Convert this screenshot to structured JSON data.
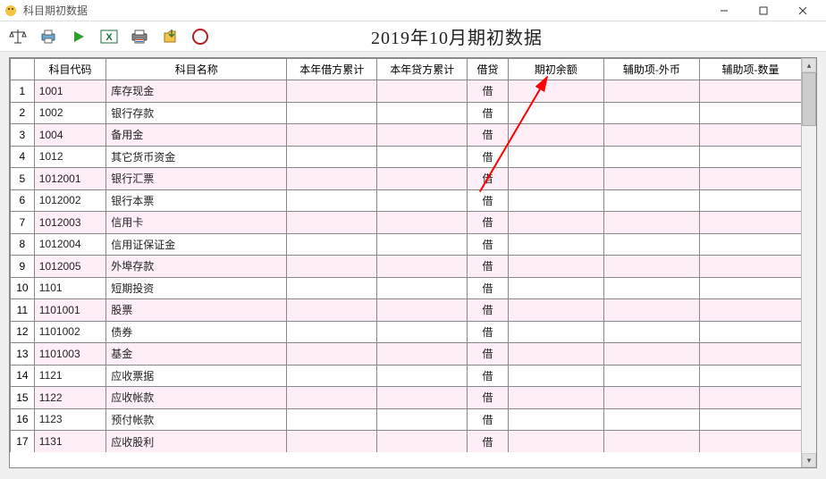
{
  "window": {
    "title": "科目期初数据"
  },
  "header_title": "2019年10月期初数据",
  "toolbar_icons": [
    "balance",
    "print",
    "run",
    "excel",
    "printer",
    "folder",
    "stop"
  ],
  "columns": [
    "",
    "科目代码",
    "科目名称",
    "本年借方累计",
    "本年贷方累计",
    "借贷",
    "期初余额",
    "辅助项-外币",
    "辅助项-数量"
  ],
  "rows": [
    {
      "idx": "1",
      "code": "1001",
      "name": "库存现金",
      "db": "",
      "cr": "",
      "jd": "借",
      "bal": "",
      "fx": "",
      "qty": ""
    },
    {
      "idx": "2",
      "code": "1002",
      "name": "银行存款",
      "db": "",
      "cr": "",
      "jd": "借",
      "bal": "",
      "fx": "",
      "qty": ""
    },
    {
      "idx": "3",
      "code": "1004",
      "name": "备用金",
      "db": "",
      "cr": "",
      "jd": "借",
      "bal": "",
      "fx": "",
      "qty": ""
    },
    {
      "idx": "4",
      "code": "1012",
      "name": "其它货币资金",
      "db": "",
      "cr": "",
      "jd": "借",
      "bal": "",
      "fx": "",
      "qty": ""
    },
    {
      "idx": "5",
      "code": "1012001",
      "name": "银行汇票",
      "db": "",
      "cr": "",
      "jd": "借",
      "bal": "",
      "fx": "",
      "qty": ""
    },
    {
      "idx": "6",
      "code": "1012002",
      "name": "银行本票",
      "db": "",
      "cr": "",
      "jd": "借",
      "bal": "",
      "fx": "",
      "qty": ""
    },
    {
      "idx": "7",
      "code": "1012003",
      "name": "信用卡",
      "db": "",
      "cr": "",
      "jd": "借",
      "bal": "",
      "fx": "",
      "qty": ""
    },
    {
      "idx": "8",
      "code": "1012004",
      "name": "信用证保证金",
      "db": "",
      "cr": "",
      "jd": "借",
      "bal": "",
      "fx": "",
      "qty": ""
    },
    {
      "idx": "9",
      "code": "1012005",
      "name": "外埠存款",
      "db": "",
      "cr": "",
      "jd": "借",
      "bal": "",
      "fx": "",
      "qty": ""
    },
    {
      "idx": "10",
      "code": "1101",
      "name": "短期投资",
      "db": "",
      "cr": "",
      "jd": "借",
      "bal": "",
      "fx": "",
      "qty": ""
    },
    {
      "idx": "11",
      "code": "1101001",
      "name": "股票",
      "db": "",
      "cr": "",
      "jd": "借",
      "bal": "",
      "fx": "",
      "qty": ""
    },
    {
      "idx": "12",
      "code": "1101002",
      "name": "债券",
      "db": "",
      "cr": "",
      "jd": "借",
      "bal": "",
      "fx": "",
      "qty": ""
    },
    {
      "idx": "13",
      "code": "1101003",
      "name": "基金",
      "db": "",
      "cr": "",
      "jd": "借",
      "bal": "",
      "fx": "",
      "qty": ""
    },
    {
      "idx": "14",
      "code": "1121",
      "name": "应收票据",
      "db": "",
      "cr": "",
      "jd": "借",
      "bal": "",
      "fx": "",
      "qty": ""
    },
    {
      "idx": "15",
      "code": "1122",
      "name": "应收帐款",
      "db": "",
      "cr": "",
      "jd": "借",
      "bal": "",
      "fx": "",
      "qty": ""
    },
    {
      "idx": "16",
      "code": "1123",
      "name": "预付帐款",
      "db": "",
      "cr": "",
      "jd": "借",
      "bal": "",
      "fx": "",
      "qty": ""
    },
    {
      "idx": "17",
      "code": "1131",
      "name": "应收股利",
      "db": "",
      "cr": "",
      "jd": "借",
      "bal": "",
      "fx": "",
      "qty": ""
    }
  ]
}
